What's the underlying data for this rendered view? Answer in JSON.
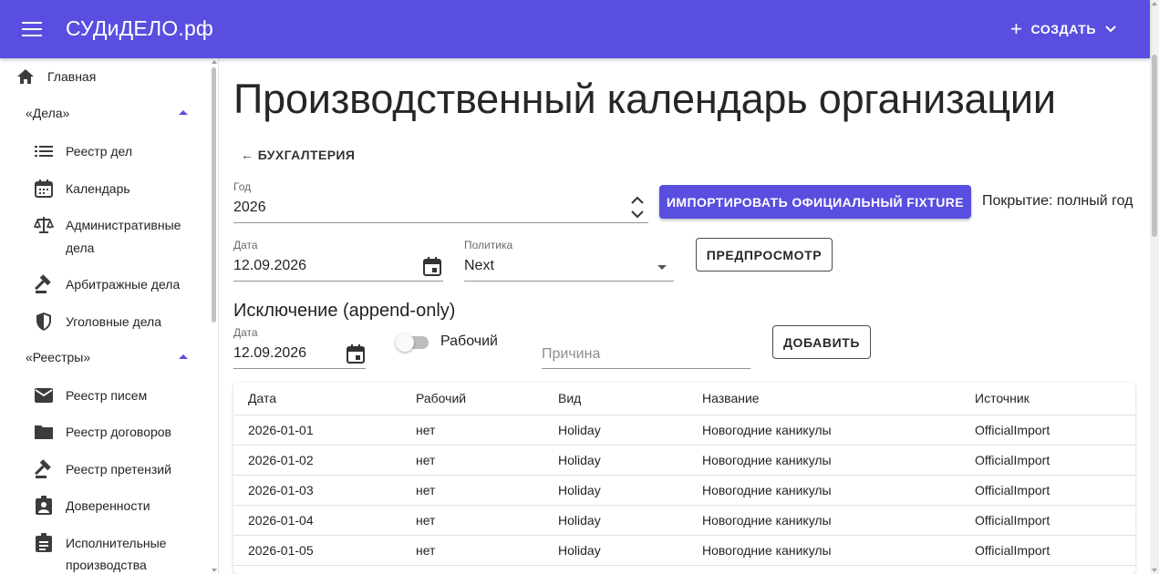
{
  "app": {
    "brand": "СУДиДЕЛО.рф",
    "create_label": "СОЗДАТЬ"
  },
  "colors": {
    "primary": "#5a4ee0"
  },
  "sidebar": {
    "home": {
      "label": "Главная",
      "icon": "home-icon"
    },
    "group_cases": "«Дела»",
    "cases": [
      {
        "label": "Реестр дел",
        "icon": "list-icon"
      },
      {
        "label": "Календарь",
        "icon": "calendar-icon"
      },
      {
        "label": "Административные",
        "label2": "дела",
        "icon": "scales-icon"
      },
      {
        "label": "Арбитражные дела",
        "icon": "gavel-icon"
      },
      {
        "label": "Уголовные дела",
        "icon": "shield-icon"
      }
    ],
    "group_registries": "«Реестры»",
    "registries": [
      {
        "label": "Реестр писем",
        "icon": "mail-icon"
      },
      {
        "label": "Реестр договоров",
        "icon": "folder-icon"
      },
      {
        "label": "Реестр претензий",
        "icon": "gavel-icon"
      },
      {
        "label": "Доверенности",
        "icon": "badge-icon"
      },
      {
        "label": "Исполнительные",
        "label2": "производства",
        "icon": "assignment-icon"
      }
    ]
  },
  "page": {
    "title": "Производственный календарь организации",
    "back_label": "← БУХГАЛТЕРИЯ",
    "year": {
      "label": "Год",
      "value": "2026"
    },
    "import_button": "ИМПОРТИРОВАТЬ ОФИЦИАЛЬНЫЙ FIXTURE",
    "coverage": "Покрытие: полный год",
    "date": {
      "label": "Дата",
      "value": "12.09.2026"
    },
    "policy": {
      "label": "Политика",
      "value": "Next"
    },
    "preview_button": "ПРЕДПРОСМОТР",
    "exception_title": "Исключение (append-only)",
    "exception_date": {
      "label": "Дата",
      "value": "12.09.2026"
    },
    "working_toggle": {
      "label": "Рабочий",
      "checked": false
    },
    "reason_placeholder": "Причина",
    "add_button": "ДОБАВИТЬ"
  },
  "table": {
    "columns": [
      "Дата",
      "Рабочий",
      "Вид",
      "Название",
      "Источник"
    ],
    "rows": [
      [
        "2026-01-01",
        "нет",
        "Holiday",
        "Новогодние каникулы",
        "OfficialImport"
      ],
      [
        "2026-01-02",
        "нет",
        "Holiday",
        "Новогодние каникулы",
        "OfficialImport"
      ],
      [
        "2026-01-03",
        "нет",
        "Holiday",
        "Новогодние каникулы",
        "OfficialImport"
      ],
      [
        "2026-01-04",
        "нет",
        "Holiday",
        "Новогодние каникулы",
        "OfficialImport"
      ],
      [
        "2026-01-05",
        "нет",
        "Holiday",
        "Новогодние каникулы",
        "OfficialImport"
      ]
    ]
  }
}
